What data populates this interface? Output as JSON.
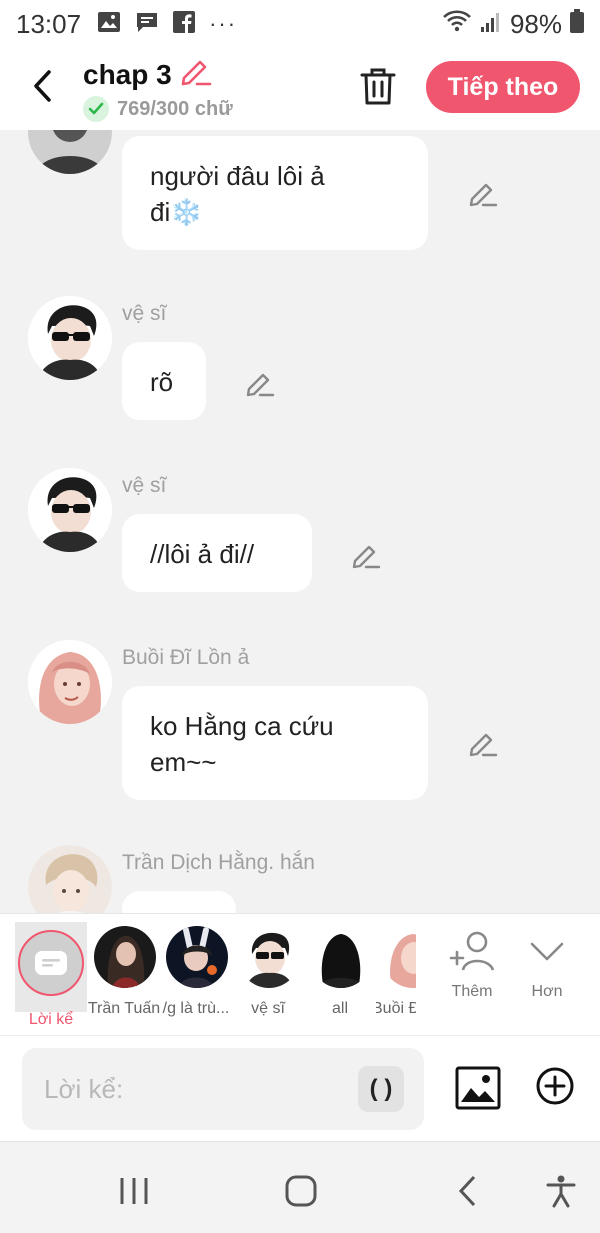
{
  "status_bar": {
    "time": "13:07",
    "battery": "98%",
    "icons": [
      "gallery-icon",
      "message-icon",
      "facebook-icon",
      "more-icon",
      "wifi-icon",
      "signal-icon",
      "battery-icon"
    ]
  },
  "header": {
    "title": "chap 3",
    "word_count": "769/300 chữ",
    "next_label": "Tiếp theo",
    "accent_color": "#f0566e"
  },
  "messages": [
    {
      "speaker": "",
      "text_lines": [
        "người đâu lôi ả",
        "đi❄️"
      ]
    },
    {
      "speaker": "vệ sĩ",
      "text_lines": [
        "rõ"
      ]
    },
    {
      "speaker": "vệ sĩ",
      "text_lines": [
        "//lôi ả đi//"
      ]
    },
    {
      "speaker": "Buồi Đĩ Lồn ả",
      "text_lines": [
        "ko Hằng ca cứu",
        "em~~"
      ]
    },
    {
      "speaker": "Trần Dịch Hằng. hắn",
      "text_lines": [
        ""
      ]
    }
  ],
  "characters": {
    "narrator_label": "Lời kể",
    "items": [
      {
        "label": "Trần Tuấn"
      },
      {
        "label": "/g là trù..."
      },
      {
        "label": "vệ sĩ"
      },
      {
        "label": "all"
      },
      {
        "label": "Buồi Đ"
      }
    ],
    "add_label": "Thêm",
    "more_label": "Hơn"
  },
  "input": {
    "placeholder": "Lời kể:",
    "paren_label": "( )"
  }
}
